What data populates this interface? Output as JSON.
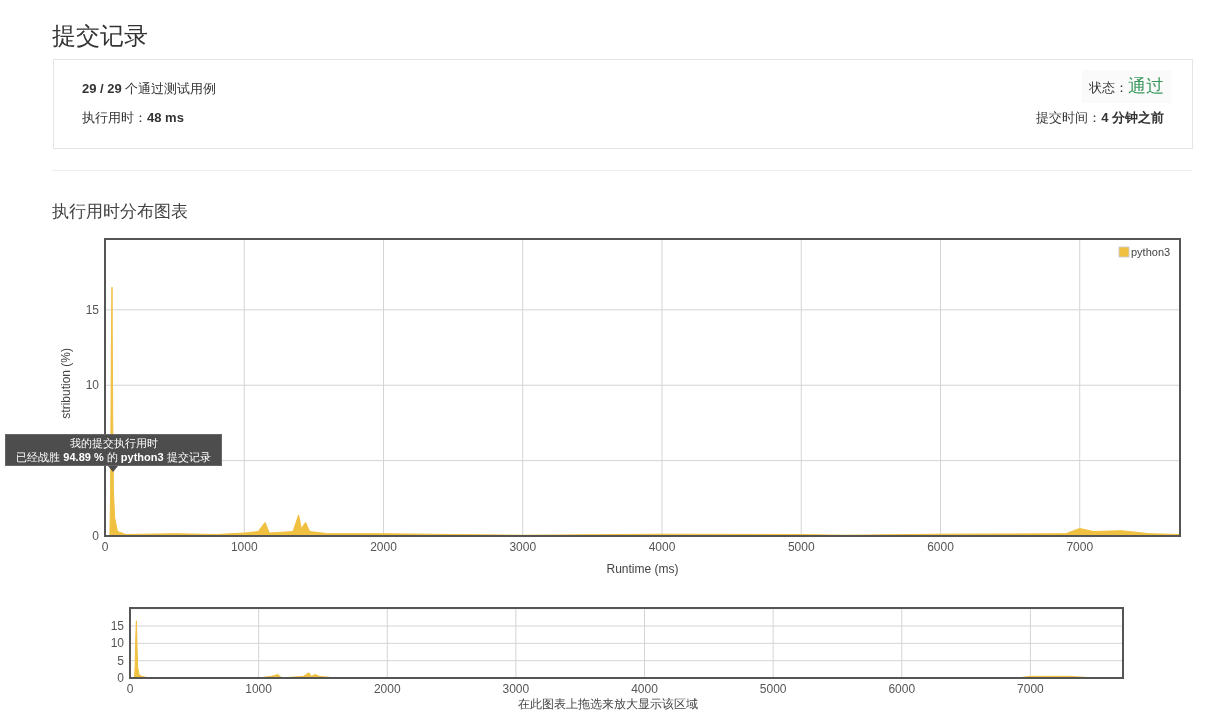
{
  "page_title": "提交记录",
  "summary": {
    "tests": "**29 / 29** 个通过测试用例",
    "runtime": "执行用时：**48 ms**",
    "status_label": "状态：",
    "status_value": "通过",
    "submitted": "提交时间：**4 分钟之前**"
  },
  "section_title": "执行用时分布图表",
  "chart": {
    "chart_data": {
      "type": "area",
      "grid": true,
      "xlabel": "Runtime (ms)",
      "ylabel": "stribution (%)",
      "xlim": [
        0,
        7720
      ],
      "ylim": [
        0,
        19.7
      ],
      "xticks": [
        0,
        1000,
        2000,
        3000,
        4000,
        5000,
        6000,
        7000
      ],
      "yticks": [
        0,
        10,
        15
      ],
      "x": [
        0,
        35,
        40,
        45,
        50,
        55,
        60,
        70,
        90,
        150,
        500,
        800,
        1000,
        1100,
        1150,
        1180,
        1350,
        1390,
        1410,
        1440,
        1470,
        1600,
        2000,
        2500,
        3000,
        4000,
        5000,
        5300,
        6000,
        6900,
        7000,
        7100,
        7300,
        7500,
        7720
      ],
      "series": [
        {
          "name": "python3",
          "color": "#f0c040",
          "values": [
            0,
            0,
            3,
            12,
            16.5,
            8,
            3,
            1.2,
            0.3,
            0.1,
            0.15,
            0.1,
            0.2,
            0.3,
            0.9,
            0.2,
            0.3,
            1.4,
            0.5,
            0.9,
            0.3,
            0.15,
            0.15,
            0.1,
            0.05,
            0.12,
            0.1,
            0.05,
            0.12,
            0.15,
            0.5,
            0.3,
            0.35,
            0.15,
            0.1
          ]
        }
      ]
    },
    "tooltip": {
      "line1": "我的提交执行用时",
      "line2": "已经战胜 **94.89 %** 的 **python3** 提交记录"
    }
  },
  "overview": {
    "chart_data": {
      "type": "area",
      "grid": true,
      "xlim": [
        0,
        7720
      ],
      "ylim": [
        0,
        20.2
      ],
      "xticks": [
        0,
        1000,
        2000,
        3000,
        4000,
        5000,
        6000,
        7000
      ],
      "yticks": [
        0,
        5,
        10,
        15
      ],
      "x": [
        0,
        35,
        40,
        45,
        50,
        55,
        60,
        70,
        90,
        150,
        500,
        800,
        1000,
        1100,
        1150,
        1180,
        1350,
        1390,
        1410,
        1440,
        1470,
        1600,
        2000,
        2500,
        3000,
        4000,
        5000,
        5300,
        6000,
        6900,
        7000,
        7100,
        7300,
        7500,
        7720
      ],
      "series": [
        {
          "color": "#f0c040",
          "values": [
            0,
            0,
            3,
            12,
            16.5,
            8,
            3,
            1,
            0.5,
            0,
            0,
            0,
            0,
            0.5,
            1,
            0,
            0.5,
            1.5,
            0.5,
            1,
            0.5,
            0,
            0,
            0,
            0,
            0,
            0,
            0,
            0,
            0,
            0.5,
            0.5,
            0.5,
            0,
            0
          ]
        }
      ]
    },
    "caption": "在此图表上拖选来放大显示该区域"
  }
}
